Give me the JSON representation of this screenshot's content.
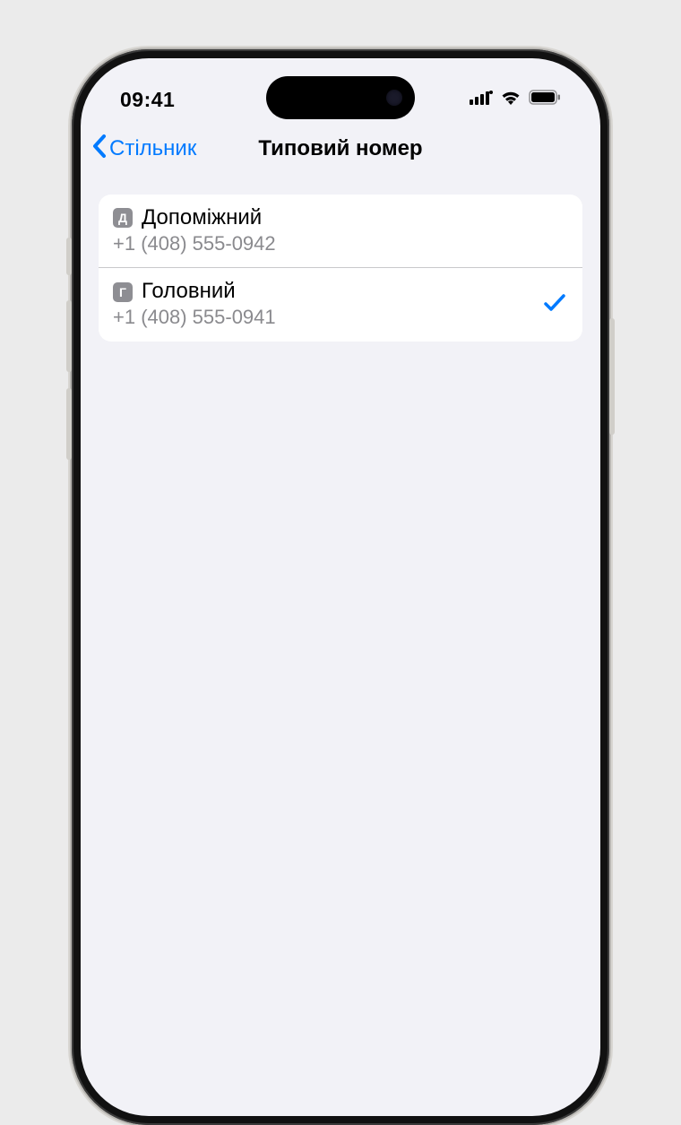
{
  "status_bar": {
    "time": "09:41"
  },
  "nav": {
    "back_label": "Стільник",
    "title": "Типовий номер"
  },
  "lines": [
    {
      "badge": "Д",
      "name": "Допоміжний",
      "number": "+1 (408) 555-0942",
      "selected": false
    },
    {
      "badge": "Г",
      "name": "Головний",
      "number": "+1 (408) 555-0941",
      "selected": true
    }
  ],
  "colors": {
    "accent": "#007aff",
    "bg": "#f2f2f7",
    "card": "#ffffff",
    "secondary": "#8a8a8e"
  },
  "icons": {
    "cellular": "cellular-icon",
    "wifi": "wifi-icon",
    "battery": "battery-icon",
    "back": "chevron-left-icon",
    "check": "checkmark-icon"
  }
}
